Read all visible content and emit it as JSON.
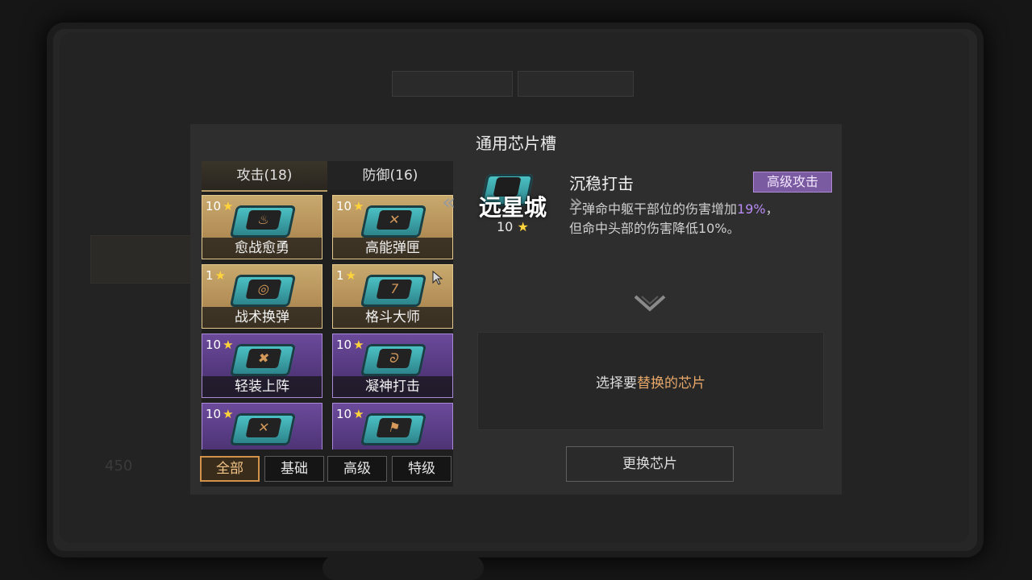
{
  "background": {
    "number_text": "450"
  },
  "dialog": {
    "title": "通用芯片槽"
  },
  "tabs": [
    {
      "label": "攻击(18)",
      "active": true
    },
    {
      "label": "防御(16)",
      "active": false
    }
  ],
  "chips": [
    {
      "level": "10",
      "name": "愈战愈勇",
      "rarity": "gold",
      "glyph": "♨"
    },
    {
      "level": "10",
      "name": "高能弹匣",
      "rarity": "gold",
      "glyph": "✕"
    },
    {
      "level": "1",
      "name": "战术换弹",
      "rarity": "gold",
      "glyph": "◎"
    },
    {
      "level": "1",
      "name": "格斗大师",
      "rarity": "gold",
      "glyph": "7"
    },
    {
      "level": "10",
      "name": "轻装上阵",
      "rarity": "purple",
      "glyph": "✖"
    },
    {
      "level": "10",
      "name": "凝神打击",
      "rarity": "purple",
      "glyph": "ᘐ"
    },
    {
      "level": "10",
      "name": "",
      "rarity": "purple",
      "glyph": "✕"
    },
    {
      "level": "10",
      "name": "",
      "rarity": "purple",
      "glyph": "⚑"
    }
  ],
  "star": "★",
  "filters": [
    {
      "label": "全部",
      "active": true
    },
    {
      "label": "基础",
      "active": false
    },
    {
      "label": "高级",
      "active": false
    },
    {
      "label": "特级",
      "active": false
    }
  ],
  "detail": {
    "name": "沉稳打击",
    "level": "10",
    "badge": "高级攻击",
    "desc_line1_prefix": "子弹命中躯干部位的伤害增加",
    "desc_line1_value": "19%",
    "desc_line1_suffix": "，",
    "desc_line2": "但命中头部的伤害降低10%。"
  },
  "replace": {
    "prompt_prefix": "选择要",
    "prompt_accent": "替换的芯片",
    "button": "更换芯片"
  },
  "location": {
    "name": "远星城",
    "left_arrow": "«",
    "right_arrow": "»"
  },
  "colors": {
    "gold_card": "#b59058",
    "purple_card": "#55397f",
    "accent_orange": "#d2924a",
    "badge_purple": "#7a5aa0",
    "highlight_purple": "#b98cf5"
  }
}
